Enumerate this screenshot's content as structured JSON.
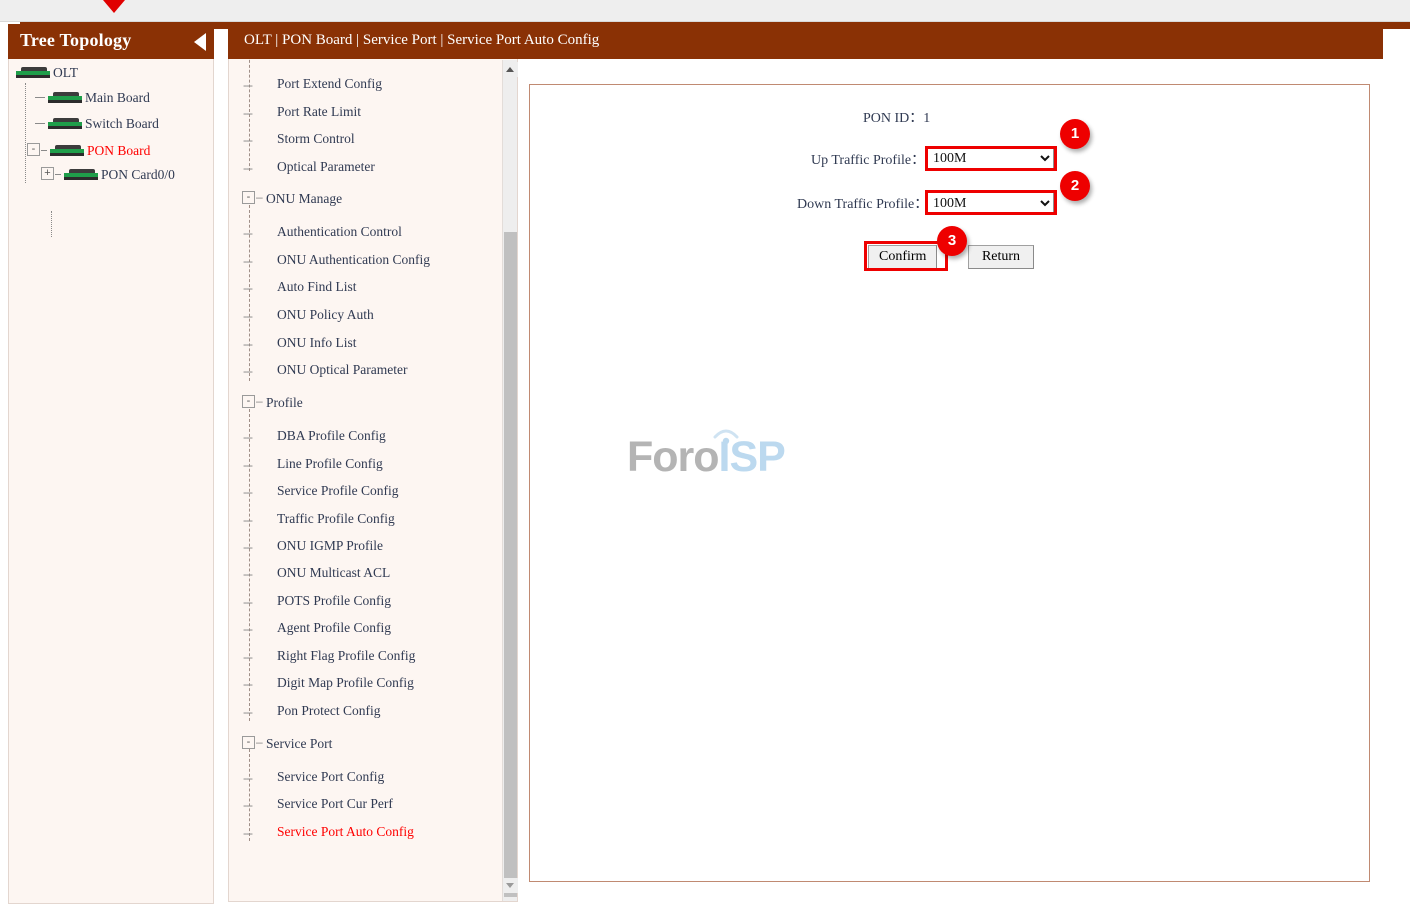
{
  "breadcrumb": "OLT | PON Board | Service Port | Service Port Auto Config",
  "tree_panel": {
    "title": "Tree Topology",
    "collapse_icon": "triangle-left-icon",
    "nodes": [
      {
        "label": "OLT",
        "toggle": "",
        "icon": "device-icon",
        "selected": false
      },
      {
        "label": "Main Board",
        "toggle": "",
        "icon": "device-icon",
        "selected": false
      },
      {
        "label": "Switch Board",
        "toggle": "",
        "icon": "device-icon",
        "selected": false
      },
      {
        "label": "PON Board",
        "toggle": "-",
        "icon": "device-icon",
        "selected": true
      },
      {
        "label": "PON Card0/0",
        "toggle": "+",
        "icon": "device-icon",
        "selected": false
      }
    ]
  },
  "menu": {
    "scrollbar": {
      "up_icon": "triangle-up-icon",
      "down_icon": "triangle-down-icon"
    },
    "items": [
      {
        "label": "Port Extend Config",
        "type": "leaf",
        "selected": false
      },
      {
        "label": "Port Rate Limit",
        "type": "leaf",
        "selected": false
      },
      {
        "label": "Storm Control",
        "type": "leaf",
        "selected": false
      },
      {
        "label": "Optical Parameter",
        "type": "leaf",
        "selected": false
      },
      {
        "label": "ONU Manage",
        "type": "group",
        "toggle": "-"
      },
      {
        "label": "Authentication Control",
        "type": "leaf",
        "selected": false
      },
      {
        "label": "ONU Authentication Config",
        "type": "leaf",
        "selected": false
      },
      {
        "label": "Auto Find List",
        "type": "leaf",
        "selected": false
      },
      {
        "label": "ONU Policy Auth",
        "type": "leaf",
        "selected": false
      },
      {
        "label": "ONU Info List",
        "type": "leaf",
        "selected": false
      },
      {
        "label": "ONU Optical Parameter",
        "type": "leaf",
        "selected": false
      },
      {
        "label": "Profile",
        "type": "group",
        "toggle": "-"
      },
      {
        "label": "DBA Profile Config",
        "type": "leaf",
        "selected": false
      },
      {
        "label": "Line Profile Config",
        "type": "leaf",
        "selected": false
      },
      {
        "label": "Service Profile Config",
        "type": "leaf",
        "selected": false
      },
      {
        "label": "Traffic Profile Config",
        "type": "leaf",
        "selected": false
      },
      {
        "label": "ONU IGMP Profile",
        "type": "leaf",
        "selected": false
      },
      {
        "label": "ONU Multicast ACL",
        "type": "leaf",
        "selected": false
      },
      {
        "label": "POTS Profile Config",
        "type": "leaf",
        "selected": false
      },
      {
        "label": "Agent Profile Config",
        "type": "leaf",
        "selected": false
      },
      {
        "label": "Right Flag Profile Config",
        "type": "leaf",
        "selected": false
      },
      {
        "label": "Digit Map Profile Config",
        "type": "leaf",
        "selected": false
      },
      {
        "label": "Pon Protect Config",
        "type": "leaf",
        "selected": false
      },
      {
        "label": "Service Port",
        "type": "group",
        "toggle": "-"
      },
      {
        "label": "Service Port Config",
        "type": "leaf",
        "selected": false
      },
      {
        "label": "Service Port Cur Perf",
        "type": "leaf",
        "selected": false
      },
      {
        "label": "Service Port Auto Config",
        "type": "leaf",
        "selected": true
      }
    ]
  },
  "form": {
    "pon_id_label": "PON ID",
    "pon_id_sep": "：",
    "pon_id_value": "1",
    "up_label": "Up Traffic Profile",
    "up_sep": "：",
    "up_value": "100M",
    "up_options": [
      "100M"
    ],
    "down_label": "Down Traffic Profile",
    "down_sep": "：",
    "down_value": "100M",
    "down_options": [
      "100M"
    ],
    "confirm_label": "Confirm",
    "return_label": "Return"
  },
  "annotations": {
    "badge1": "1",
    "badge2": "2",
    "badge3": "3",
    "color": "#ee0000"
  },
  "watermark": {
    "part_a": "Foro",
    "part_b": "ISP",
    "color_a": "#b4b4b4",
    "color_b": "#bcd9ef"
  },
  "theme": {
    "brand": "#8a3105",
    "panel_bg": "#fdf6f2",
    "accent_red": "#ff0000"
  }
}
